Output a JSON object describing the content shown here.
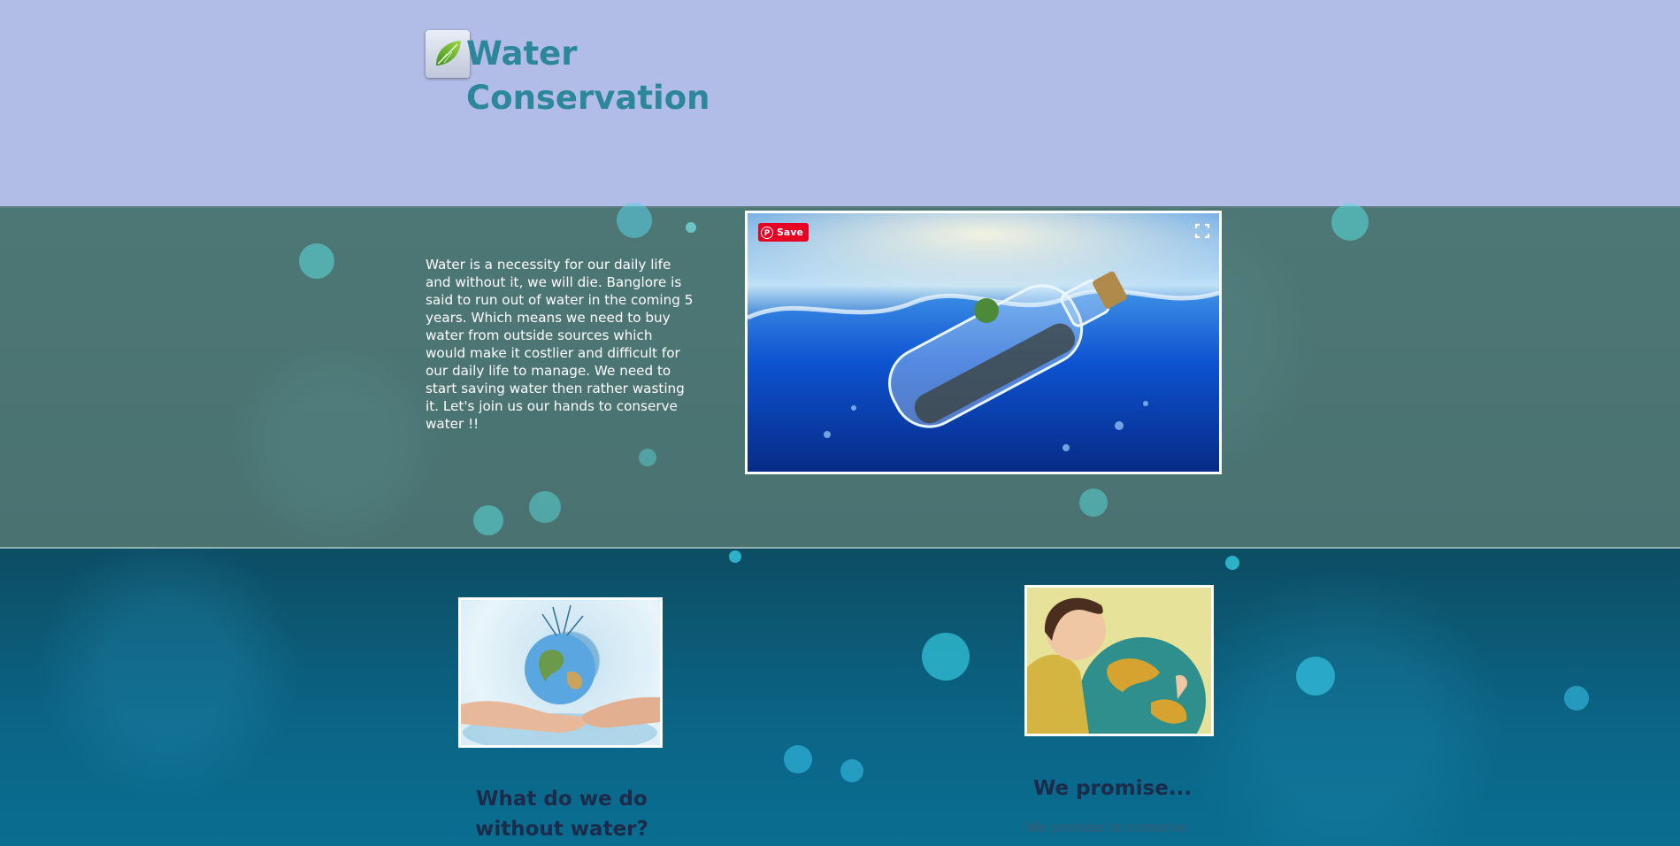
{
  "header": {
    "title_line1": "Water",
    "title_line2": "Conservation",
    "logo_icon": "leaf-icon"
  },
  "intro": {
    "text": "Water is a necessity for our daily life and without it, we will die. Banglore is said to run out of water in the coming 5 years. Which means we need to buy water from outside sources which would make it costlier and difficult for our daily life to manage. We need to start saving water then rather wasting it. Let's join us our hands to conserve water !!"
  },
  "hero": {
    "save_label": "Save",
    "expand_icon": "expand-icon"
  },
  "cards": {
    "left_title": "What do we do without water?",
    "right_title": "We promise...",
    "right_text": "We promise to conserve"
  },
  "colors": {
    "header_bg": "#b1bce7",
    "title": "#2b8799",
    "strip1_bg": "#4b7473",
    "strip2_bg": "#0b6587",
    "pinterest": "#e60023"
  }
}
